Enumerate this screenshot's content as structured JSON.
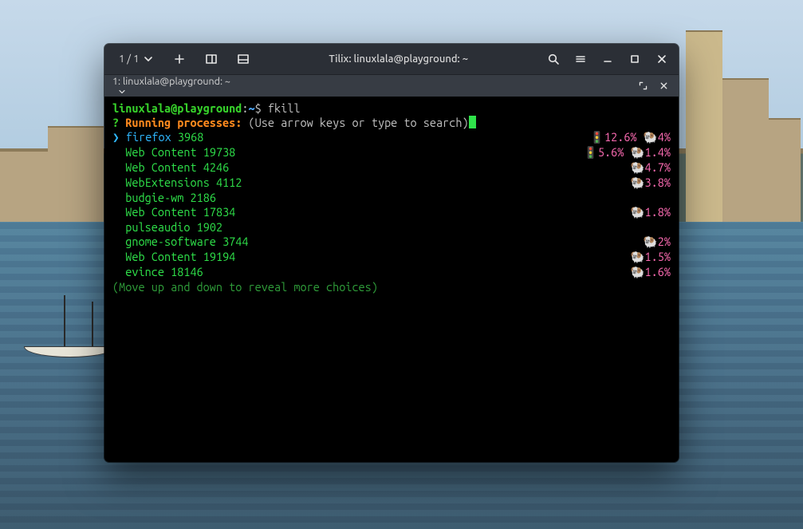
{
  "window": {
    "session_counter": "1 / 1",
    "title": "Tilix: linuxlala@playground: ~"
  },
  "tab": {
    "label": "1: linuxlala@playground: ~"
  },
  "prompt": {
    "user": "linuxlala",
    "at": "@",
    "host": "playground",
    "colon": ":",
    "path": "~",
    "sigil": "$ ",
    "command": "fkill"
  },
  "fkill": {
    "question_mark": "?",
    "header": "Running processes:",
    "hint": "(Use arrow keys or type to search)",
    "footer": "(Move up and down to reveal more choices)",
    "arrow": "❯",
    "processes": [
      {
        "name": "firefox",
        "pid": "3968",
        "selected": true,
        "cpu": "12.6%",
        "cpu_icon": "🚦",
        "ram": "4%",
        "ram_icon": "🐏"
      },
      {
        "name": "Web Content",
        "pid": "19738",
        "selected": false,
        "cpu": "5.6%",
        "cpu_icon": "🚦",
        "ram": "1.4%",
        "ram_icon": "🐏"
      },
      {
        "name": "Web Content",
        "pid": "4246",
        "selected": false,
        "cpu": "",
        "cpu_icon": "",
        "ram": "4.7%",
        "ram_icon": "🐏"
      },
      {
        "name": "WebExtensions",
        "pid": "4112",
        "selected": false,
        "cpu": "",
        "cpu_icon": "",
        "ram": "3.8%",
        "ram_icon": "🐏"
      },
      {
        "name": "budgie-wm",
        "pid": "2186",
        "selected": false,
        "cpu": "",
        "cpu_icon": "",
        "ram": "",
        "ram_icon": ""
      },
      {
        "name": "Web Content",
        "pid": "17834",
        "selected": false,
        "cpu": "",
        "cpu_icon": "",
        "ram": "1.8%",
        "ram_icon": "🐏"
      },
      {
        "name": "pulseaudio",
        "pid": "1902",
        "selected": false,
        "cpu": "",
        "cpu_icon": "",
        "ram": "",
        "ram_icon": ""
      },
      {
        "name": "gnome-software",
        "pid": "3744",
        "selected": false,
        "cpu": "",
        "cpu_icon": "",
        "ram": "2%",
        "ram_icon": "🐏"
      },
      {
        "name": "Web Content",
        "pid": "19194",
        "selected": false,
        "cpu": "",
        "cpu_icon": "",
        "ram": "1.5%",
        "ram_icon": "🐏"
      },
      {
        "name": "evince",
        "pid": "18146",
        "selected": false,
        "cpu": "",
        "cpu_icon": "",
        "ram": "1.6%",
        "ram_icon": "🐏"
      }
    ]
  }
}
